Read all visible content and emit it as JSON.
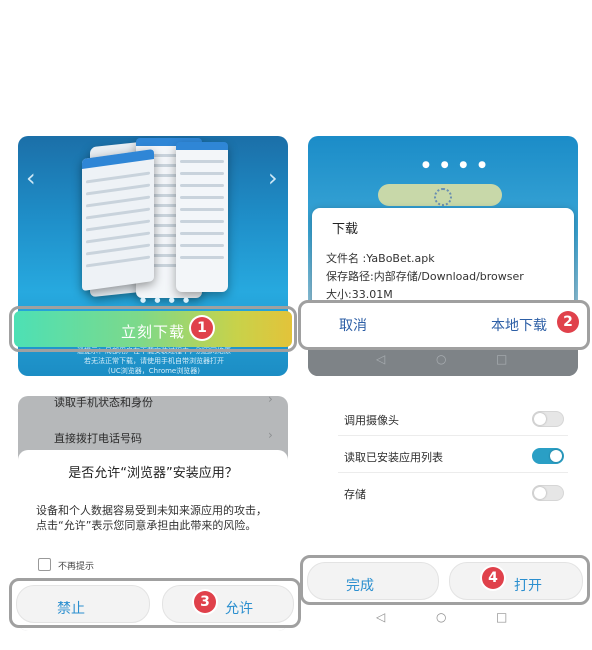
{
  "step1": {
    "button_label": "立刻下载",
    "badge": "1",
    "caption_lines": [
      "溫提示：局部用户在下载安装过程中，别因网络原",
      "若无法正常下载，请使用手机自带浏览器打开",
      "(UC浏览器，Chrome浏览器)"
    ],
    "arrow_left": "‹",
    "arrow_right": "›"
  },
  "step2": {
    "dialog_title": "下载",
    "file_name": "文件名 :YaBoBet.apk",
    "save_path": "保存路径:内部存储/Download/browser",
    "size": "大小:33.01M",
    "cancel_label": "取消",
    "local_download_label": "本地下载",
    "badge": "2"
  },
  "step3": {
    "items": [
      "读取手机状态和身份",
      "直接拨打电话号码"
    ],
    "dialog_title": "是否允许“浏览器”安装应用？",
    "dialog_body": "设备和个人数据容易受到未知来源应用的攻击，点击“允许”表示您同意承担由此带来的风险。",
    "checkbox_label": "不再提示",
    "forbid_label": "禁止",
    "allow_label": "允许",
    "badge": "3"
  },
  "step4": {
    "permissions": [
      {
        "label": "调用摄像头",
        "enabled": false
      },
      {
        "label": "读取已安装应用列表",
        "enabled": true
      },
      {
        "label": "存储",
        "enabled": false
      }
    ],
    "done_label": "完成",
    "open_label": "打开",
    "badge": "4"
  },
  "nav": {
    "back": "◁",
    "home": "○",
    "recent": "□"
  },
  "colors": {
    "badge": "#e0414b",
    "link": "#2b8fcf",
    "toggle_on": "#2a9fc5"
  }
}
